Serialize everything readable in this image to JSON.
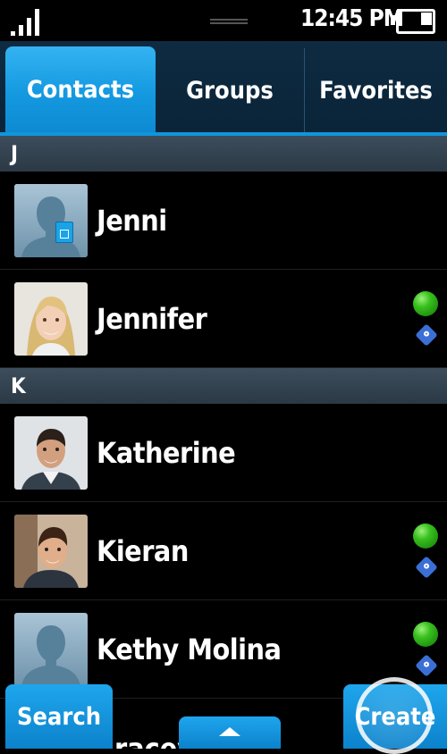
{
  "status_bar": {
    "time": "12:45 PM",
    "signal_icon": "signal-strength-icon",
    "battery_icon": "battery-icon"
  },
  "tabs": [
    {
      "label": "Contacts",
      "active": true
    },
    {
      "label": "Groups",
      "active": false
    },
    {
      "label": "Favorites",
      "active": false
    }
  ],
  "sections": [
    {
      "letter": "J",
      "contacts": [
        {
          "name": "Jenni",
          "avatar": "default-avatar-icon",
          "sim_contact": true,
          "online": false,
          "gtalk": false
        },
        {
          "name": "Jennifer",
          "avatar": "photo-avatar",
          "sim_contact": false,
          "online": true,
          "gtalk": true
        }
      ]
    },
    {
      "letter": "K",
      "contacts": [
        {
          "name": "Katherine",
          "avatar": "photo-avatar",
          "sim_contact": false,
          "online": false,
          "gtalk": false
        },
        {
          "name": "Kieran",
          "avatar": "photo-avatar",
          "sim_contact": false,
          "online": true,
          "gtalk": true
        },
        {
          "name": "Kethy Molina",
          "avatar": "default-avatar-icon",
          "sim_contact": false,
          "online": true,
          "gtalk": true
        }
      ]
    }
  ],
  "action_bar": {
    "search_label": "Search",
    "up_icon": "arrow-up-icon",
    "create_label": "Create"
  },
  "colors": {
    "accent": "#1499e0",
    "tab_bar": "#0e2b42",
    "section_header": "#34434f",
    "online": "#39c11e",
    "gtalk": "#3b6fd6"
  }
}
